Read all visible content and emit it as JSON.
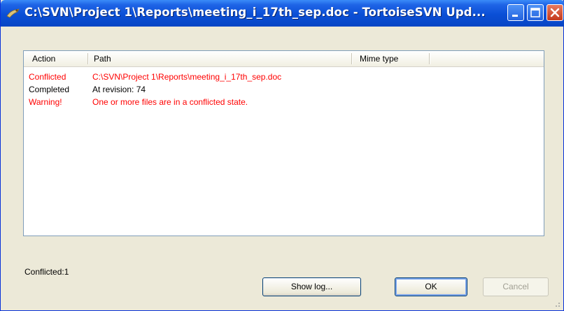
{
  "window": {
    "title": "C:\\SVN\\Project 1\\Reports\\meeting_i_17th_sep.doc - TortoiseSVN Upd..."
  },
  "list": {
    "columns": [
      "Action",
      "Path",
      "Mime type"
    ],
    "rows": [
      {
        "action": "Conflicted",
        "path": "C:\\SVN\\Project 1\\Reports\\meeting_i_17th_sep.doc",
        "color": "#ff0000"
      },
      {
        "action": "Completed",
        "path": "At revision: 74",
        "color": "#000000"
      },
      {
        "action": "Warning!",
        "path": "One or more files are in a conflicted state.",
        "color": "#ff0000"
      }
    ]
  },
  "status": {
    "text": "Conflicted:1"
  },
  "buttons": {
    "show_log": "Show log...",
    "ok": "OK",
    "cancel": "Cancel"
  },
  "colors": {
    "titlebar": "#0a4fd6",
    "conflict": "#ff0000",
    "dialog_bg": "#ece9d8"
  }
}
